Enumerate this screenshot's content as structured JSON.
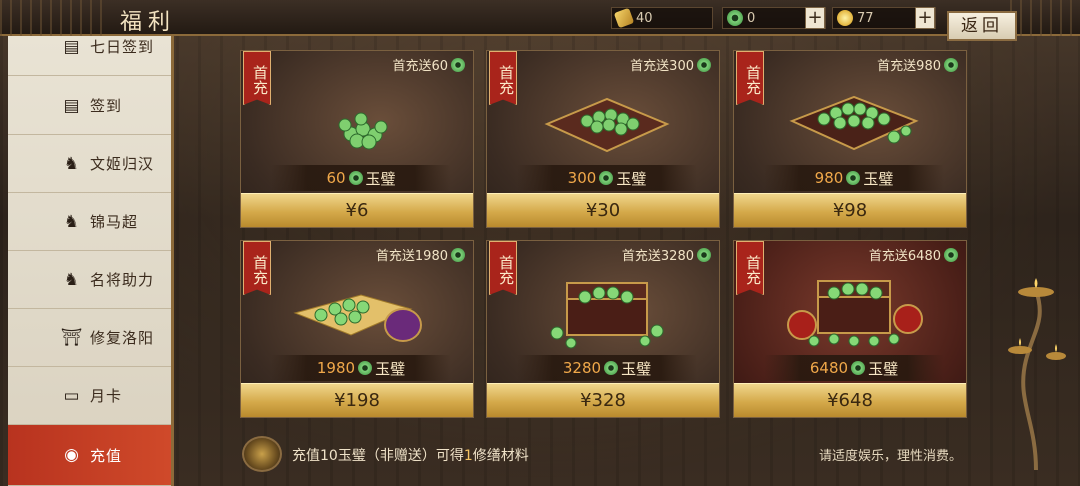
{
  "header": {
    "title": "福利",
    "back_label": "返回",
    "resources": [
      {
        "icon": "gold-ingot-icon",
        "value": "40"
      },
      {
        "icon": "jade-coin-icon",
        "value": "0"
      },
      {
        "icon": "copper-coin-icon",
        "value": "77"
      }
    ],
    "plus_label": "+"
  },
  "sidebar": {
    "items": [
      {
        "label": "七日签到",
        "icon": "calendar-icon"
      },
      {
        "label": "签到",
        "icon": "checklist-icon"
      },
      {
        "label": "文姬归汉",
        "icon": "hero-icon"
      },
      {
        "label": "锦马超",
        "icon": "hero-icon"
      },
      {
        "label": "名将助力",
        "icon": "hero-icon"
      },
      {
        "label": "修复洛阳",
        "icon": "pavilion-icon"
      },
      {
        "label": "月卡",
        "icon": "card-icon"
      },
      {
        "label": "充值",
        "icon": "recharge-icon",
        "active": true
      }
    ]
  },
  "cards": [
    {
      "ribbon": "首充",
      "bonus": "首充送60",
      "amount": "60",
      "unit": "玉璧",
      "price": "¥6"
    },
    {
      "ribbon": "首充",
      "bonus": "首充送300",
      "amount": "300",
      "unit": "玉璧",
      "price": "¥30"
    },
    {
      "ribbon": "首充",
      "bonus": "首充送980",
      "amount": "980",
      "unit": "玉璧",
      "price": "¥98"
    },
    {
      "ribbon": "首充",
      "bonus": "首充送1980",
      "amount": "1980",
      "unit": "玉璧",
      "price": "¥198"
    },
    {
      "ribbon": "首充",
      "bonus": "首充送3280",
      "amount": "3280",
      "unit": "玉璧",
      "price": "¥328"
    },
    {
      "ribbon": "首充",
      "bonus": "首充送6480",
      "amount": "6480",
      "unit": "玉璧",
      "price": "¥648"
    }
  ],
  "footer": {
    "tip_prefix": "充值10玉璧（非赠送）可得",
    "tip_highlight": "1",
    "tip_suffix": "修缮材料",
    "advisory": "请适度娱乐，理性消费。"
  },
  "colors": {
    "accent_red": "#b8331f",
    "price_gold": "#d4a94a",
    "amount_orange": "#f0a84a"
  }
}
